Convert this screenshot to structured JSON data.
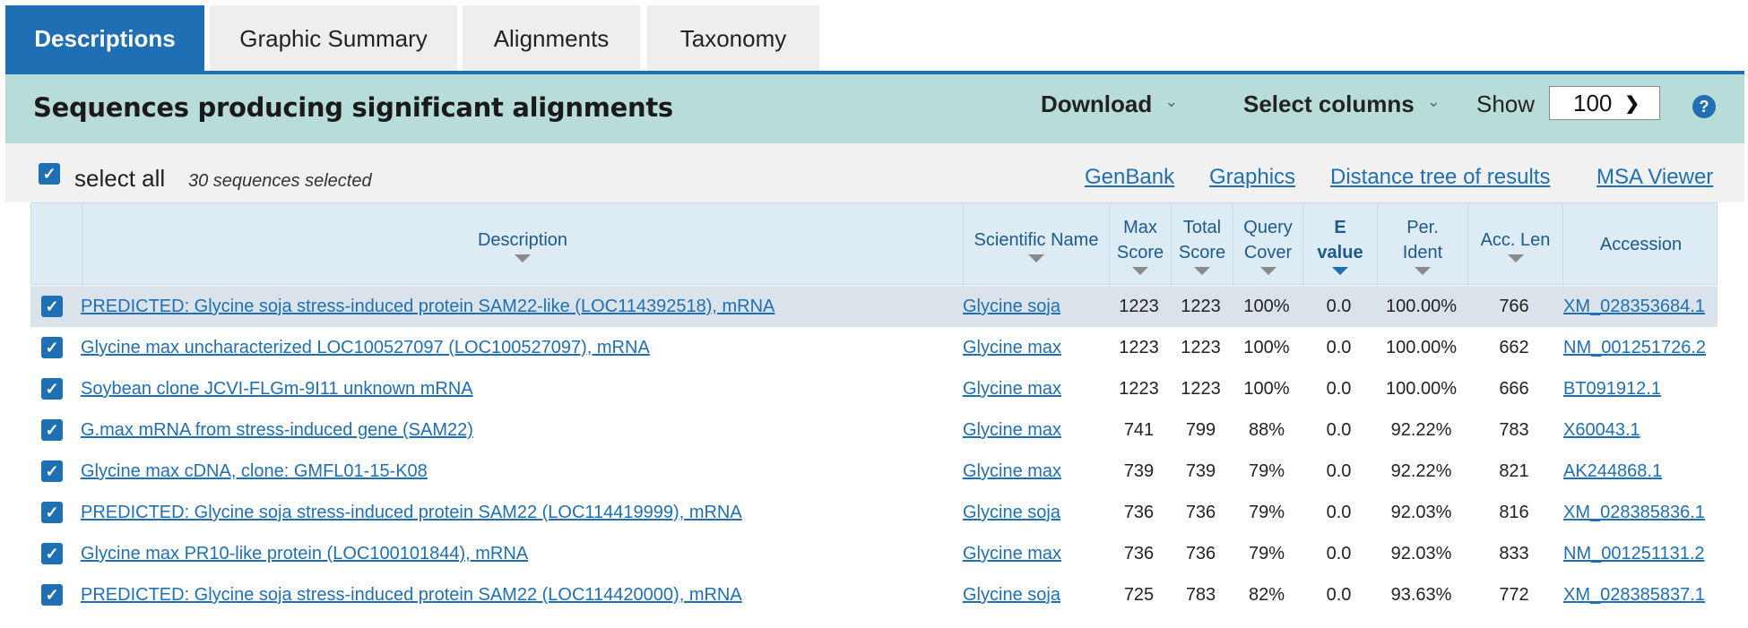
{
  "tabs": [
    "Descriptions",
    "Graphic Summary",
    "Alignments",
    "Taxonomy"
  ],
  "header": {
    "title": "Sequences producing significant alignments",
    "download_label": "Download",
    "select_columns_label": "Select columns",
    "show_label": "Show",
    "show_value": "100",
    "help": "?"
  },
  "selection": {
    "select_all_label": "select all",
    "count_text": "30 sequences selected",
    "links": [
      "GenBank",
      "Graphics",
      "Distance tree of results",
      "MSA Viewer"
    ]
  },
  "columns": {
    "description": "Description",
    "scientific_name": "Scientific Name",
    "max_score": [
      "Max",
      "Score"
    ],
    "total_score": [
      "Total",
      "Score"
    ],
    "query_cover": [
      "Query",
      "Cover"
    ],
    "e_value": [
      "E",
      "value"
    ],
    "per_ident": [
      "Per.",
      "Ident"
    ],
    "acc_len": "Acc. Len",
    "accession": "Accession"
  },
  "rows": [
    {
      "description": "PREDICTED: Glycine soja stress-induced protein SAM22-like (LOC114392518), mRNA",
      "sci": "Glycine soja",
      "max": "1223",
      "total": "1223",
      "cover": "100%",
      "evalue": "0.0",
      "ident": "100.00%",
      "len": "766",
      "acc": "XM_028353684.1"
    },
    {
      "description": "Glycine max uncharacterized LOC100527097 (LOC100527097), mRNA",
      "sci": "Glycine max",
      "max": "1223",
      "total": "1223",
      "cover": "100%",
      "evalue": "0.0",
      "ident": "100.00%",
      "len": "662",
      "acc": "NM_001251726.2"
    },
    {
      "description": "Soybean clone JCVI-FLGm-9I11 unknown mRNA",
      "sci": "Glycine max",
      "max": "1223",
      "total": "1223",
      "cover": "100%",
      "evalue": "0.0",
      "ident": "100.00%",
      "len": "666",
      "acc": "BT091912.1"
    },
    {
      "description": "G.max mRNA from stress-induced gene (SAM22)",
      "sci": "Glycine max",
      "max": "741",
      "total": "799",
      "cover": "88%",
      "evalue": "0.0",
      "ident": "92.22%",
      "len": "783",
      "acc": "X60043.1"
    },
    {
      "description": "Glycine max cDNA, clone: GMFL01-15-K08",
      "sci": "Glycine max",
      "max": "739",
      "total": "739",
      "cover": "79%",
      "evalue": "0.0",
      "ident": "92.22%",
      "len": "821",
      "acc": "AK244868.1"
    },
    {
      "description": "PREDICTED: Glycine soja stress-induced protein SAM22 (LOC114419999), mRNA",
      "sci": "Glycine soja",
      "max": "736",
      "total": "736",
      "cover": "79%",
      "evalue": "0.0",
      "ident": "92.03%",
      "len": "816",
      "acc": "XM_028385836.1"
    },
    {
      "description": "Glycine max PR10-like protein (LOC100101844), mRNA",
      "sci": "Glycine max",
      "max": "736",
      "total": "736",
      "cover": "79%",
      "evalue": "0.0",
      "ident": "92.03%",
      "len": "833",
      "acc": "NM_001251131.2"
    },
    {
      "description": "PREDICTED: Glycine soja stress-induced protein SAM22 (LOC114420000), mRNA",
      "sci": "Glycine soja",
      "max": "725",
      "total": "783",
      "cover": "82%",
      "evalue": "0.0",
      "ident": "93.63%",
      "len": "772",
      "acc": "XM_028385837.1"
    }
  ]
}
